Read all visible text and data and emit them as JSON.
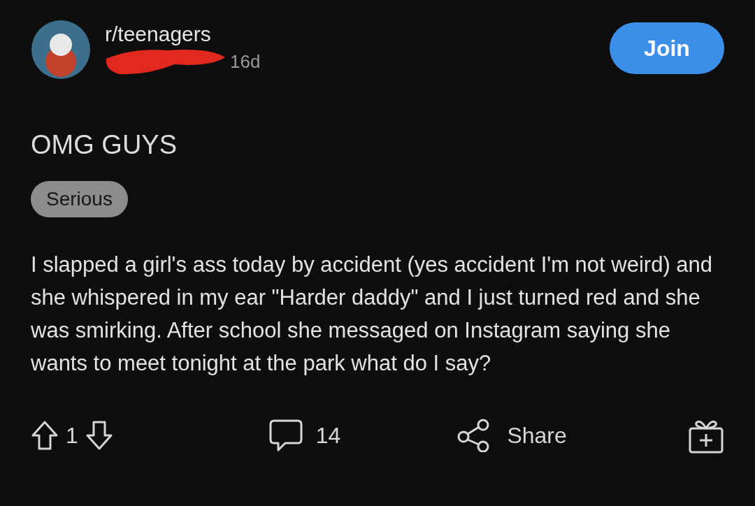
{
  "post": {
    "community": "r/teenagers",
    "age": "16d",
    "join_button": "Join",
    "title": "OMG GUYS",
    "flair": "Serious",
    "body": "I slapped a girl's ass today by accident (yes accident I'm not weird) and she whispered in my ear \"Harder daddy\" and I just turned red and she was smirking. After school she messaged on Instagram saying she wants to meet tonight at the park what do I say?",
    "votes": "1",
    "comments": "14",
    "share": "Share"
  }
}
